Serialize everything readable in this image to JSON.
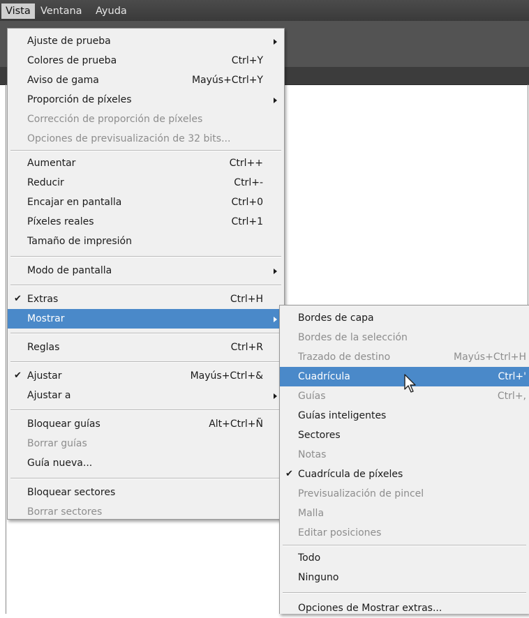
{
  "menubar": {
    "items": [
      {
        "label": "Vista",
        "active": true
      },
      {
        "label": "Ventana",
        "active": false
      },
      {
        "label": "Ayuda",
        "active": false
      }
    ]
  },
  "main_menu": {
    "items": [
      {
        "label": "Ajuste de prueba",
        "shortcut": "",
        "submenu": true,
        "disabled": false,
        "checked": false
      },
      {
        "label": "Colores de prueba",
        "shortcut": "Ctrl+Y",
        "submenu": false,
        "disabled": false,
        "checked": false
      },
      {
        "label": "Aviso de gama",
        "shortcut": "Mayús+Ctrl+Y",
        "submenu": false,
        "disabled": false,
        "checked": false
      },
      {
        "label": "Proporción de píxeles",
        "shortcut": "",
        "submenu": true,
        "disabled": false,
        "checked": false
      },
      {
        "label": "Corrección de proporción de píxeles",
        "shortcut": "",
        "submenu": false,
        "disabled": true,
        "checked": false
      },
      {
        "label": "Opciones de previsualización de 32 bits...",
        "shortcut": "",
        "submenu": false,
        "disabled": true,
        "checked": false
      },
      {
        "label": "Aumentar",
        "shortcut": "Ctrl++",
        "submenu": false,
        "disabled": false,
        "checked": false
      },
      {
        "label": "Reducir",
        "shortcut": "Ctrl+-",
        "submenu": false,
        "disabled": false,
        "checked": false
      },
      {
        "label": "Encajar en pantalla",
        "shortcut": "Ctrl+0",
        "submenu": false,
        "disabled": false,
        "checked": false
      },
      {
        "label": "Píxeles reales",
        "shortcut": "Ctrl+1",
        "submenu": false,
        "disabled": false,
        "checked": false
      },
      {
        "label": "Tamaño de impresión",
        "shortcut": "",
        "submenu": false,
        "disabled": false,
        "checked": false
      },
      {
        "label": "Modo de pantalla",
        "shortcut": "",
        "submenu": true,
        "disabled": false,
        "checked": false
      },
      {
        "label": "Extras",
        "shortcut": "Ctrl+H",
        "submenu": false,
        "disabled": false,
        "checked": true
      },
      {
        "label": "Mostrar",
        "shortcut": "",
        "submenu": true,
        "disabled": false,
        "checked": false,
        "highlighted": true
      },
      {
        "label": "Reglas",
        "shortcut": "Ctrl+R",
        "submenu": false,
        "disabled": false,
        "checked": false
      },
      {
        "label": "Ajustar",
        "shortcut": "Mayús+Ctrl+&",
        "submenu": false,
        "disabled": false,
        "checked": true
      },
      {
        "label": "Ajustar a",
        "shortcut": "",
        "submenu": true,
        "disabled": false,
        "checked": false
      },
      {
        "label": "Bloquear guías",
        "shortcut": "Alt+Ctrl+Ñ",
        "submenu": false,
        "disabled": false,
        "checked": false
      },
      {
        "label": "Borrar guías",
        "shortcut": "",
        "submenu": false,
        "disabled": true,
        "checked": false
      },
      {
        "label": "Guía nueva...",
        "shortcut": "",
        "submenu": false,
        "disabled": false,
        "checked": false
      },
      {
        "label": "Bloquear sectores",
        "shortcut": "",
        "submenu": false,
        "disabled": false,
        "checked": false
      },
      {
        "label": "Borrar sectores",
        "shortcut": "",
        "submenu": false,
        "disabled": true,
        "checked": false
      }
    ]
  },
  "show_submenu": {
    "items": [
      {
        "label": "Bordes de capa",
        "shortcut": "",
        "disabled": false,
        "checked": false
      },
      {
        "label": "Bordes de la selección",
        "shortcut": "",
        "disabled": true,
        "checked": false
      },
      {
        "label": "Trazado de destino",
        "shortcut": "Mayús+Ctrl+H",
        "disabled": true,
        "checked": false
      },
      {
        "label": "Cuadrícula",
        "shortcut": "Ctrl+'",
        "disabled": false,
        "checked": false,
        "highlighted": true
      },
      {
        "label": "Guías",
        "shortcut": "Ctrl+,",
        "disabled": true,
        "checked": false
      },
      {
        "label": "Guías inteligentes",
        "shortcut": "",
        "disabled": false,
        "checked": false
      },
      {
        "label": "Sectores",
        "shortcut": "",
        "disabled": false,
        "checked": false
      },
      {
        "label": "Notas",
        "shortcut": "",
        "disabled": true,
        "checked": false
      },
      {
        "label": "Cuadrícula de píxeles",
        "shortcut": "",
        "disabled": false,
        "checked": true
      },
      {
        "label": "Previsualización de pincel",
        "shortcut": "",
        "disabled": true,
        "checked": false
      },
      {
        "label": "Malla",
        "shortcut": "",
        "disabled": true,
        "checked": false
      },
      {
        "label": "Editar posiciones",
        "shortcut": "",
        "disabled": true,
        "checked": false
      },
      {
        "label": "Todo",
        "shortcut": "",
        "disabled": false,
        "checked": false
      },
      {
        "label": "Ninguno",
        "shortcut": "",
        "disabled": false,
        "checked": false
      },
      {
        "label": "Opciones de Mostrar extras...",
        "shortcut": "",
        "disabled": false,
        "checked": false
      }
    ]
  },
  "colors": {
    "highlight": "#4a89c9",
    "menu_bg": "#f0f0f0",
    "disabled_text": "#8d8d8d",
    "menubar_bg": "#404040"
  },
  "icons": {
    "check": "✔",
    "cursor": "arrow-cursor-icon"
  }
}
